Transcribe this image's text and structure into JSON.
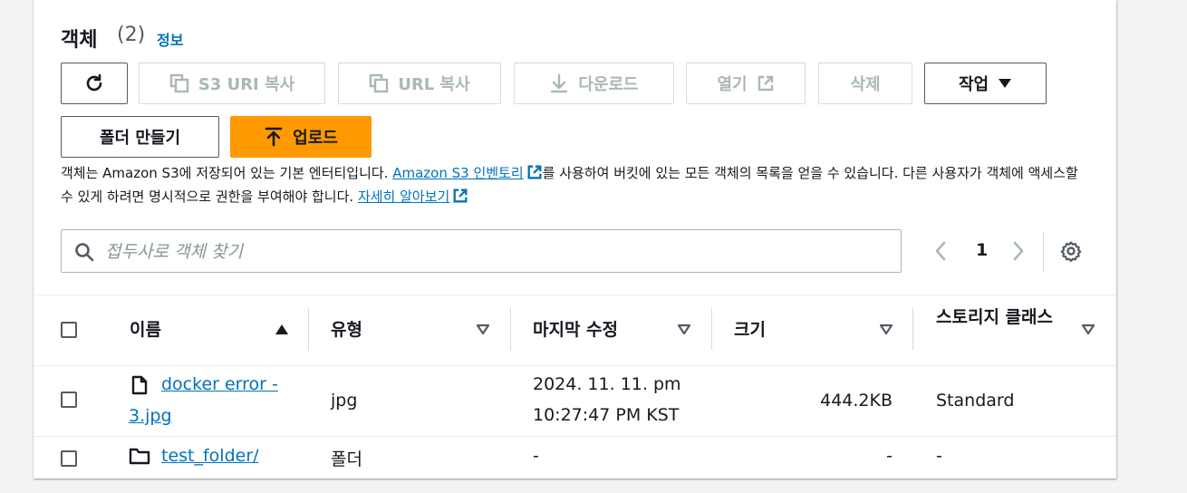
{
  "header": {
    "title": "객체",
    "count": "(2)",
    "info_link": "정보"
  },
  "toolbar": {
    "refresh_label": "refresh",
    "copy_s3_uri": "S3 URI 복사",
    "copy_url": "URL 복사",
    "download": "다운로드",
    "open": "열기",
    "delete": "삭제",
    "actions": "작업",
    "create_folder": "폴더 만들기",
    "upload": "업로드"
  },
  "description": {
    "text1": "객체는 Amazon S3에 저장되어 있는 기본 엔터티입니다. ",
    "link1": "Amazon S3 인벤토리",
    "text2": "를 사용하여 버킷에 있는 모든 객체의 목록을 얻을 수 있습니다. 다른 사용자가 객체에 액세스할 수 있게 하려면 명시적으로 권한을 부여해야 합니다. ",
    "link2": "자세히 알아보기"
  },
  "search": {
    "placeholder": "접두사로 객체 찾기"
  },
  "pagination": {
    "current_page": "1"
  },
  "table": {
    "columns": [
      "이름",
      "유형",
      "마지막 수정",
      "크기",
      "스토리지 클래스"
    ],
    "rows": [
      {
        "name_line1": "docker error -",
        "name_line2": "3.jpg",
        "type": "jpg",
        "modified_line1": "2024. 11. 11. pm",
        "modified_line2": "10:27:47 PM KST",
        "size": "444.2KB",
        "storage_class": "Standard",
        "icon": "file-icon"
      },
      {
        "name": "test_folder/",
        "type": "폴더",
        "modified": "-",
        "size": "-",
        "storage_class": "-",
        "icon": "folder-icon"
      }
    ]
  },
  "colors": {
    "link": "#0073bb",
    "primary": "#ff9900",
    "text": "#16191f",
    "disabled": "#aab7b8"
  }
}
